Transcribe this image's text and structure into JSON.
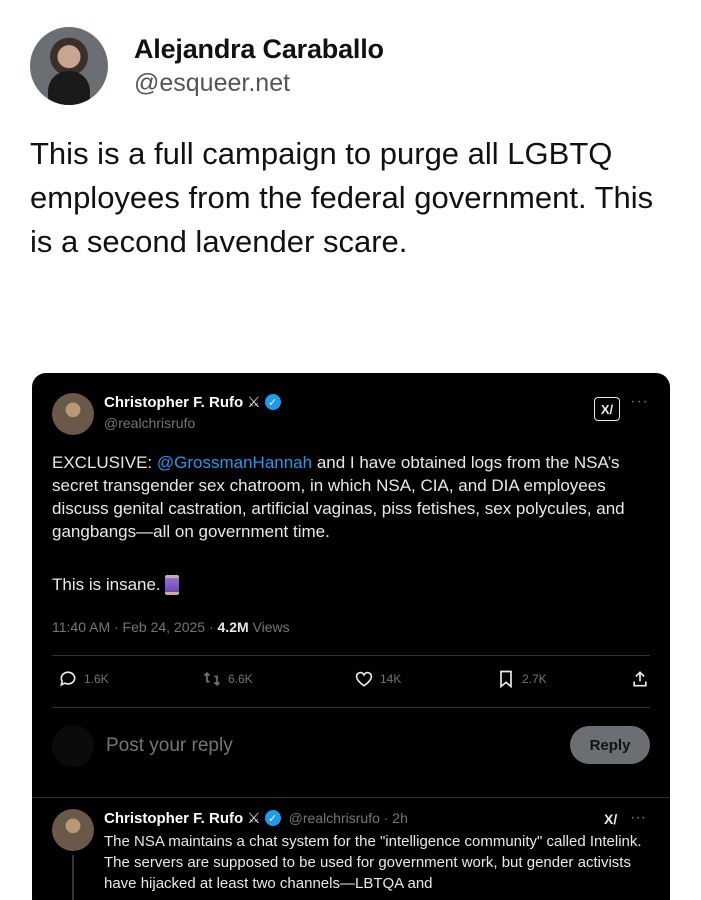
{
  "post": {
    "author_name": "Alejandra Caraballo",
    "author_handle": "@esqueer.net",
    "text": "This is a full campaign to purge all LGBTQ employees from the federal government. This is a second lavender scare."
  },
  "embed": {
    "tweet": {
      "author_name": "Christopher F. Rufo",
      "swords": "⚔",
      "verified_mark": "✓",
      "author_handle": "@realchrisrufo",
      "grok_label": "X/",
      "more": "···",
      "body_prefix": "EXCLUSIVE: ",
      "mention": "@GrossmanHannah",
      "body_suffix": " and I have obtained logs from the NSA’s secret transgender sex chatroom, in which NSA, CIA, and DIA employees discuss genital castration, artificial vaginas, piss fetishes, sex polycules, and gangbangs—all on government time.",
      "body2": "This is insane.",
      "meta_time": "11:40 AM · Feb 24, 2025 · ",
      "views_count": "4.2M",
      "views_label": " Views",
      "actions": {
        "replies": "1.6K",
        "reposts": "6.6K",
        "likes": "14K",
        "bookmarks": "2.7K"
      }
    },
    "reply_box": {
      "placeholder": "Post your reply",
      "button": "Reply"
    },
    "thread_tweet": {
      "author_name": "Christopher F. Rufo",
      "handle_time": "@realchrisrufo · 2h",
      "grok_label": "X/",
      "more": "···",
      "body": "The NSA maintains a chat system for the \"intelligence community\" called Intelink. The servers are supposed to be used for government work, but gender activists have hijacked at least two channels—LBTQA and"
    }
  },
  "colors": {
    "link": "#1d9bf0",
    "muted": "#71767b",
    "card_bg": "#000000"
  }
}
